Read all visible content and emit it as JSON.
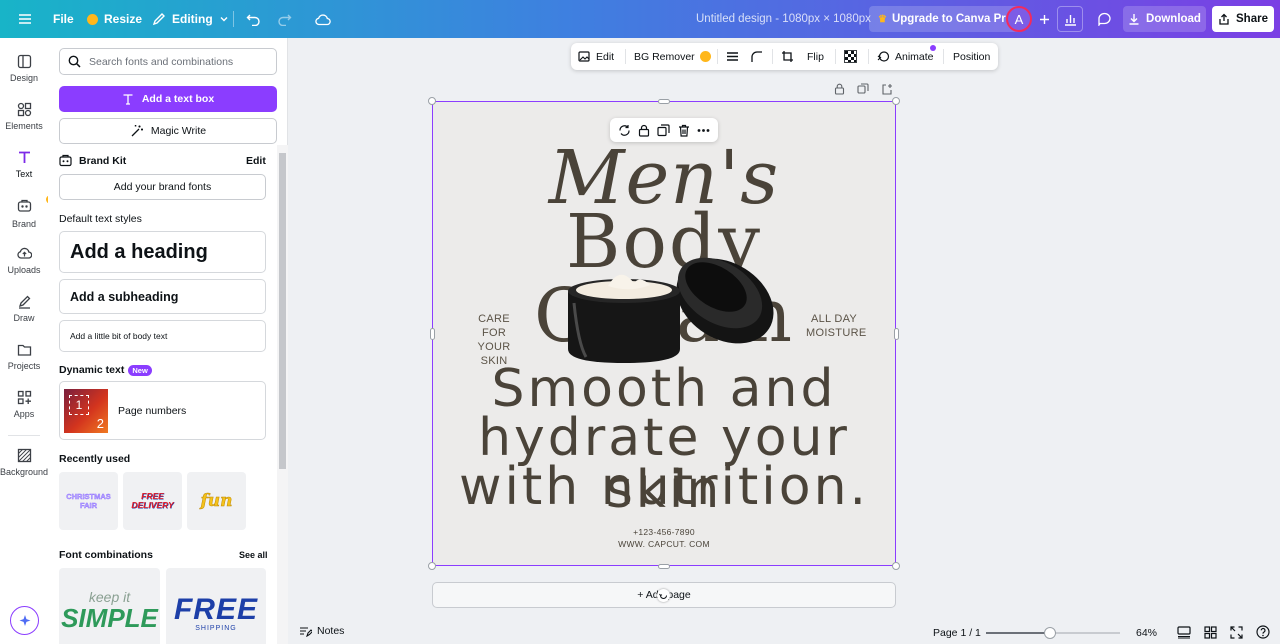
{
  "topbar": {
    "file": "File",
    "resize": "Resize",
    "editing": "Editing",
    "title": "Untitled design - 1080px × 1080px",
    "upgrade": "Upgrade to Canva Pro",
    "avatar_initial": "A",
    "download": "Download",
    "share": "Share"
  },
  "rail": {
    "items": [
      "Design",
      "Elements",
      "Text",
      "Brand",
      "Uploads",
      "Draw",
      "Projects",
      "Apps",
      "Background"
    ]
  },
  "panel": {
    "search_placeholder": "Search fonts and combinations",
    "add_text_box": "Add a text box",
    "magic_write": "Magic Write",
    "brand_kit": "Brand Kit",
    "brand_kit_edit": "Edit",
    "add_brand_fonts": "Add your brand fonts",
    "default_styles": "Default text styles",
    "heading": "Add a heading",
    "subheading": "Add a subheading",
    "body": "Add a little bit of body text",
    "dynamic_text": "Dynamic text",
    "new_badge": "New",
    "page_numbers": "Page numbers",
    "page_numbers_thumb": [
      "1",
      "2"
    ],
    "recently_used": "Recently used",
    "recent_items": [
      "CHRISTMAS FAIR",
      "FREE DELIVERY",
      "fun"
    ],
    "font_combinations": "Font combinations",
    "see_all": "See all",
    "combo_items": [
      {
        "line1": "keep it",
        "line2": "SIMPLE"
      },
      {
        "line1": "FREE",
        "line2": "SHIPPING"
      }
    ]
  },
  "context_toolbar": {
    "edit": "Edit",
    "bg_remover": "BG Remover",
    "flip": "Flip",
    "animate": "Animate",
    "position": "Position"
  },
  "design": {
    "title_line1": "Men's",
    "title_line2": "Body Cream",
    "left_text_line1": "CARE FOR",
    "left_text_line2": "YOUR SKIN",
    "right_text_line1": "ALL DAY",
    "right_text_line2": "MOISTURE",
    "tagline_line1": "Smooth and",
    "tagline_line2": "hydrate your skin",
    "tagline_line3": "with nutrition.",
    "phone": "+123-456-7890",
    "website": "WWW. CAPCUT. COM"
  },
  "add_page": "+ Add page",
  "bottombar": {
    "notes": "Notes",
    "page_indicator": "Page 1 / 1",
    "zoom": "64%",
    "zoom_level": 0.48
  },
  "colors": {
    "accent": "#8b3dff",
    "canvas_bg": "#ecebea",
    "design_text": "#4a4339"
  }
}
